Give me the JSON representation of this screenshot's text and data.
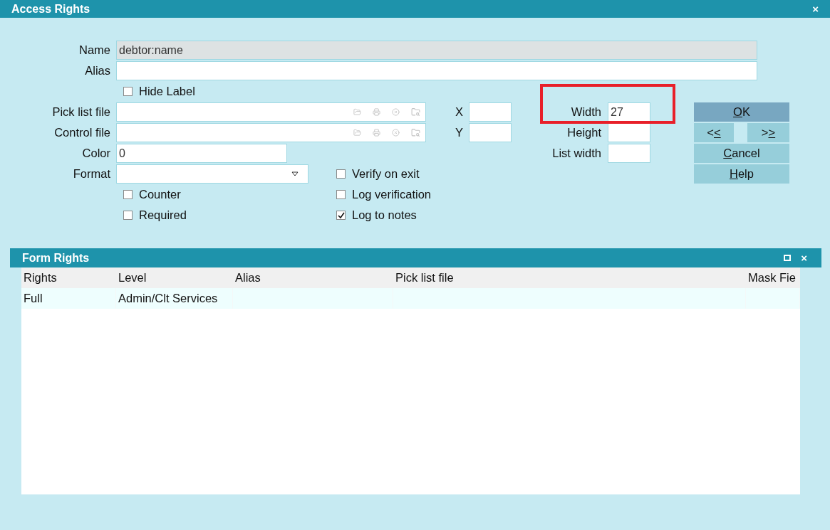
{
  "window": {
    "title": "Access Rights",
    "close": "×"
  },
  "fields": {
    "name": {
      "label": "Name",
      "value": "debtor:name",
      "disabled": true
    },
    "alias": {
      "label": "Alias"
    },
    "hide_label": {
      "label": "Hide Label",
      "checked": false
    },
    "pick_list_file": {
      "label": "Pick list file"
    },
    "control_file": {
      "label": "Control file"
    },
    "color": {
      "label": "Color",
      "value": "0"
    },
    "format": {
      "label": "Format"
    },
    "counter": {
      "label": "Counter",
      "checked": false
    },
    "required": {
      "label": "Required",
      "checked": false
    },
    "verify_on_exit": {
      "label": "Verify on exit",
      "checked": false
    },
    "log_verification": {
      "label": "Log verification",
      "checked": false
    },
    "log_to_notes": {
      "label": "Log to notes",
      "checked": true
    },
    "x": {
      "label": "X"
    },
    "y": {
      "label": "Y"
    },
    "width": {
      "label": "Width",
      "value": "27"
    },
    "height": {
      "label": "Height"
    },
    "list_width": {
      "label": "List width"
    }
  },
  "buttons": [
    {
      "label": "OK",
      "default": true
    },
    {
      "label": "<<",
      "default": false
    },
    {
      "label": ">>",
      "default": false
    },
    {
      "label": "Cancel",
      "default": false
    },
    {
      "label": "Help",
      "default": false
    }
  ],
  "annotation": {
    "kind": "rectangle",
    "color": "#e8202a"
  },
  "form_rights": {
    "title": "Form Rights",
    "close": "×",
    "columns": [
      "Rights",
      "Level",
      "Alias",
      "Pick list file",
      "Mask Fie"
    ],
    "rows": [
      [
        "Full",
        "Admin/Clt Services",
        null,
        null,
        null
      ]
    ]
  }
}
